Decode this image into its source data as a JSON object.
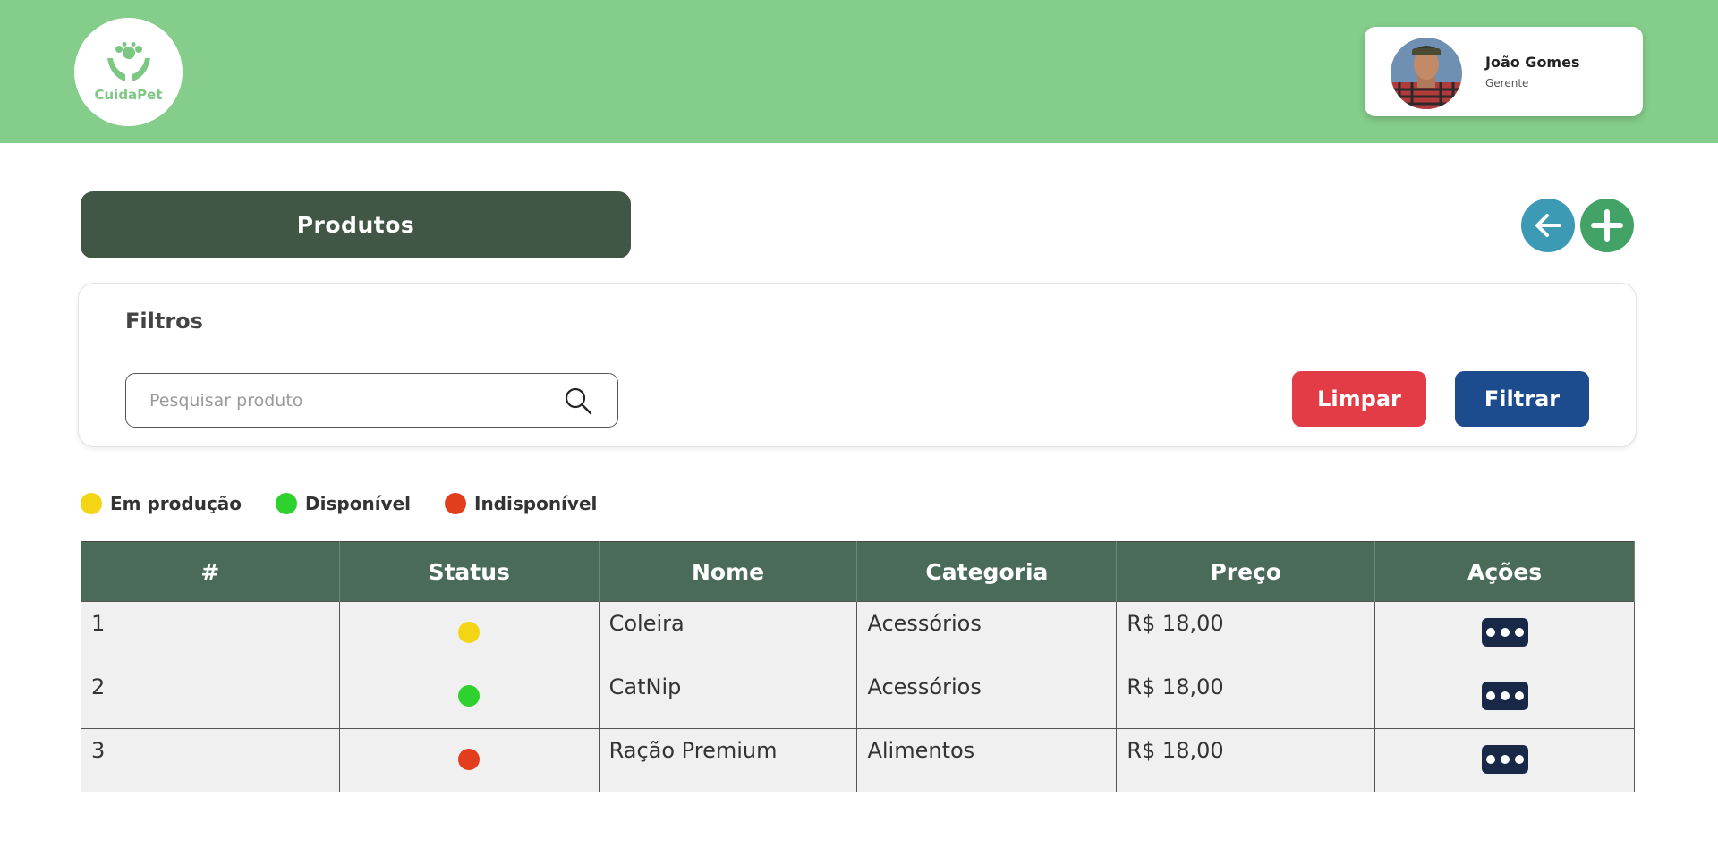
{
  "brand": {
    "name": "CuidaPet"
  },
  "user": {
    "name": "João Gomes",
    "role": "Gerente"
  },
  "page": {
    "title": "Produtos"
  },
  "actions": {
    "back_icon": "arrow-left-icon",
    "add_icon": "plus-icon"
  },
  "filters": {
    "title": "Filtros",
    "search_placeholder": "Pesquisar produto",
    "search_value": "",
    "clear_label": "Limpar",
    "filter_label": "Filtrar"
  },
  "legend": [
    {
      "label": "Em produção",
      "color": "#f3d516"
    },
    {
      "label": "Disponível",
      "color": "#2ed12e"
    },
    {
      "label": "Indisponível",
      "color": "#e23e1e"
    }
  ],
  "table": {
    "headers": [
      "#",
      "Status",
      "Nome",
      "Categoria",
      "Preço",
      "Ações"
    ],
    "rows": [
      {
        "id": "1",
        "status_color": "#f3d516",
        "name": "Coleira",
        "category": "Acessórios",
        "price": "R$ 18,00"
      },
      {
        "id": "2",
        "status_color": "#2ed12e",
        "name": "CatNip",
        "category": "Acessórios",
        "price": "R$ 18,00"
      },
      {
        "id": "3",
        "status_color": "#e23e1e",
        "name": "Ração Premium",
        "category": "Alimentos",
        "price": "R$ 18,00"
      }
    ]
  },
  "colors": {
    "header_bg": "#84cd8a",
    "title_bg": "#415644",
    "table_header_bg": "#4a6b59",
    "clear_button": "#e23c46",
    "filter_button": "#1c4b8e",
    "back_button": "#3d9ab4",
    "add_button": "#43a265",
    "action_button": "#192846"
  }
}
